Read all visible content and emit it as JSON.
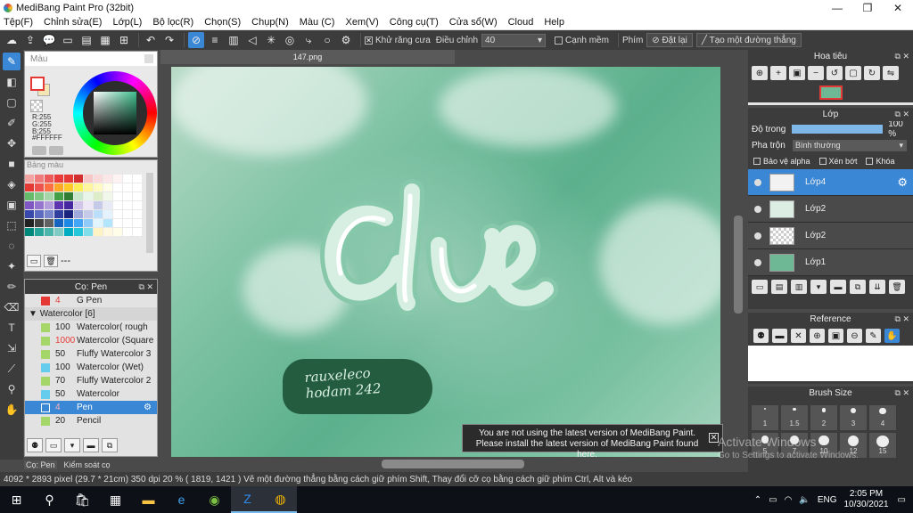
{
  "window": {
    "title": "MediBang Paint Pro (32bit)",
    "minimize": "—",
    "maximize": "❐",
    "close": "✕"
  },
  "menu": [
    "Tệp(F)",
    "Chỉnh sửa(E)",
    "Lớp(L)",
    "Bộ lọc(R)",
    "Chọn(S)",
    "Chụp(N)",
    "Màu (C)",
    "Xem(V)",
    "Công cụ(T)",
    "Cửa sổ(W)",
    "Cloud",
    "Help"
  ],
  "toolbar": {
    "antialias_label": "Khử răng cưa",
    "adjust_label": "Điều chỉnh",
    "adjust_value": "40",
    "snap_label": "Cạnh mềm",
    "key_label": "Phím",
    "reset_label": "Đặt lại",
    "new_line_label": "Tạo một đường thẳng"
  },
  "color_panel": {
    "title": "Màu",
    "rgb": "R:255\nG:255\nB:255",
    "hex": "#FFFFFF",
    "fg_color": "#ffffff",
    "bg_color": "#f3e6b4"
  },
  "swatch_panel": {
    "title": "Bảng màu",
    "footer_text": "---",
    "colors": [
      "#f4a3a3",
      "#f07b7b",
      "#ec5a5a",
      "#e83c3c",
      "#e53935",
      "#d32f2f",
      "#f7c6c6",
      "#f9d9d9",
      "#fbe7e7",
      "#fdf3f3",
      "#ffffff",
      "#ffffff",
      "#e53935",
      "#ef5350",
      "#ff7043",
      "#ffa726",
      "#ffca28",
      "#ffee58",
      "#fff59d",
      "#fff9c4",
      "#fffde7",
      "#ffffff",
      "#ffffff",
      "#ffffff",
      "#66bb6a",
      "#81c784",
      "#a5d6a7",
      "#43a047",
      "#2e7d32",
      "#c8e6c9",
      "#e8f5e9",
      "#dcedc8",
      "#f1f8e9",
      "#ffffff",
      "#ffffff",
      "#ffffff",
      "#7e57c2",
      "#9575cd",
      "#b39ddb",
      "#5e35b1",
      "#4527a0",
      "#d1c4e9",
      "#ede7f6",
      "#c5cae9",
      "#e8eaf6",
      "#ffffff",
      "#ffffff",
      "#ffffff",
      "#3949ab",
      "#5c6bc0",
      "#7986cb",
      "#303f9f",
      "#1a237e",
      "#9fa8da",
      "#c5cae9",
      "#bbdefb",
      "#e3f2fd",
      "#ffffff",
      "#ffffff",
      "#ffffff",
      "#212121",
      "#424242",
      "#616161",
      "#1565c0",
      "#1e88e5",
      "#42a5f5",
      "#90caf9",
      "#e1f5fe",
      "#b3e5fc",
      "#ffffff",
      "#ffffff",
      "#ffffff",
      "#00897b",
      "#26a69a",
      "#4db6ac",
      "#80cbc4",
      "#00acc1",
      "#26c6da",
      "#80deea",
      "#fff3c4",
      "#fff8e1",
      "#fffde7",
      "#ffffff",
      "#ffffff"
    ]
  },
  "brush_panel": {
    "title": "Cọ: Pen",
    "first": {
      "size": "4",
      "name": "G Pen",
      "color": "#e53935"
    },
    "category": "Watercolor [6]",
    "items": [
      {
        "size": "100",
        "name": "Watercolor( rough",
        "color": "#a5d66a"
      },
      {
        "size": "1000",
        "name": "Watercolor (Square",
        "color": "#a5d66a"
      },
      {
        "size": "50",
        "name": "Fluffy Watercolor 3",
        "color": "#a5d66a"
      },
      {
        "size": "100",
        "name": "Watercolor (Wet)",
        "color": "#66ccee"
      },
      {
        "size": "70",
        "name": "Fluffy Watercolor 2",
        "color": "#a5d66a"
      },
      {
        "size": "50",
        "name": "Watercolor",
        "color": "#66ccee"
      }
    ],
    "selected": {
      "size": "4",
      "name": "Pen",
      "color": "#3a87d6"
    },
    "last": {
      "size": "20",
      "name": "Pencil",
      "color": "#a5d66a"
    },
    "tabs": [
      "Cọ: Pen",
      "Kiểm soát cọ"
    ]
  },
  "document": {
    "tab": "147.png",
    "signature_line1": "rauxeleco",
    "signature_line2": "hodam 242"
  },
  "notice": {
    "line1": "You are not using the latest version of MediBang Paint.",
    "line2": "Please install the latest version of MediBang Paint found here."
  },
  "navigator": {
    "title": "Hoa tiêu"
  },
  "layers": {
    "title": "Lớp",
    "opacity_label": "Độ trong",
    "opacity_value": "100 %",
    "opacity_fraction": 1.0,
    "blend_label": "Pha trộn",
    "blend_value": "Bình thường",
    "checks": [
      "Bảo vệ alpha",
      "Xén bớt",
      "Khóa"
    ],
    "items": [
      {
        "name": "Lớp4",
        "selected": true
      },
      {
        "name": "Lớp2",
        "selected": false
      },
      {
        "name": "Lớp2",
        "selected": false
      },
      {
        "name": "Lớp1",
        "selected": false
      }
    ]
  },
  "reference": {
    "title": "Reference"
  },
  "brush_size": {
    "title": "Brush Size",
    "sizes": [
      "1",
      "1.5",
      "2",
      "3",
      "4",
      "5",
      "7",
      "10",
      "12",
      "15"
    ]
  },
  "status": {
    "text": "4092 * 2893 pixel  (29.7 * 21cm)  350 dpi  20 %  ( 1819, 1421 )  Vẽ một đường thẳng bằng cách giữ phím Shift, Thay đổi cỡ cọ bằng cách giữ phím Ctrl, Alt và kéo"
  },
  "watermark": {
    "line1": "Activate Windows",
    "line2": "Go to Settings to activate Windows."
  },
  "taskbar": {
    "lang": "ENG",
    "time": "2:05 PM",
    "date": "10/30/2021"
  },
  "colors": {
    "accent": "#3a87d6",
    "panel_dark": "#3c3c3c",
    "canvas_green": "#5cb08c",
    "stamp_green": "#245c3f"
  }
}
